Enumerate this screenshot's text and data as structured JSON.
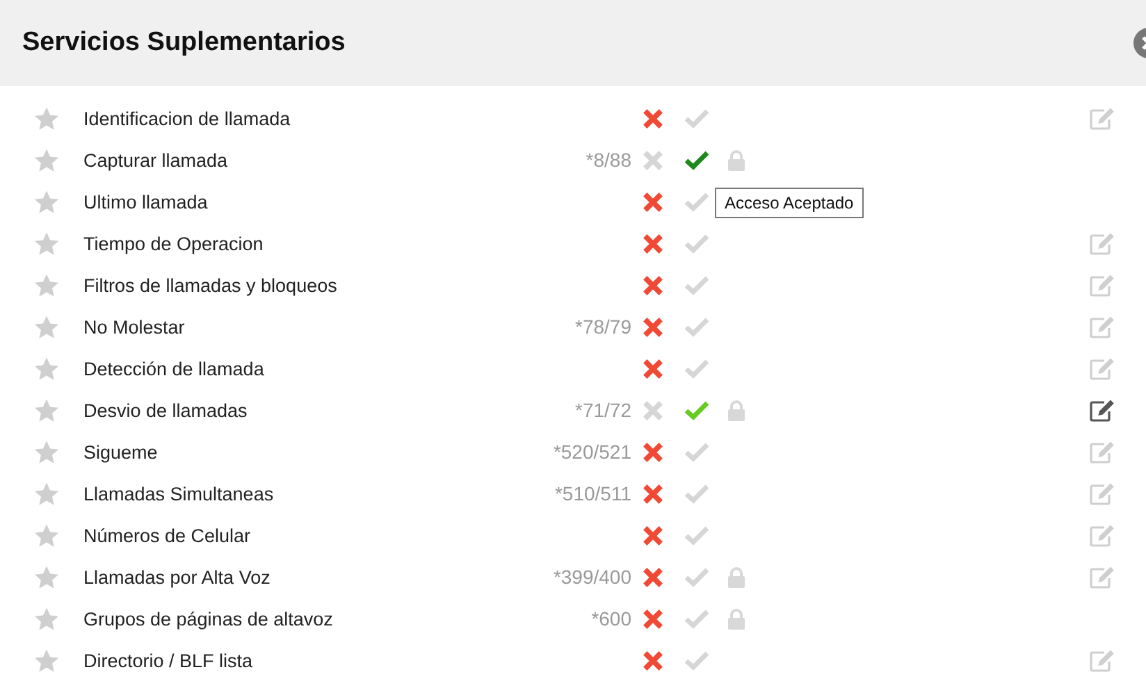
{
  "header": {
    "title": "Servicios Suplementarios"
  },
  "services": [
    {
      "name": "Identificacion de llamada",
      "denied": true,
      "accepted": false,
      "editable": true
    },
    {
      "name": "Capturar llamada",
      "code": "*8/88",
      "denied": false,
      "accepted": true,
      "color": "#1e8a1e",
      "locked": true
    },
    {
      "name": "Ultimo llamada",
      "denied": true,
      "accepted": false,
      "tooltip": "Acceso Aceptado"
    },
    {
      "name": "Tiempo de Operacion",
      "denied": true,
      "accepted": false,
      "editable": true
    },
    {
      "name": "Filtros de llamadas y bloqueos",
      "denied": true,
      "accepted": false,
      "editable": true
    },
    {
      "name": "No Molestar",
      "code": "*78/79",
      "denied": true,
      "accepted": false,
      "editable": true
    },
    {
      "name": "Detección de llamada",
      "denied": true,
      "accepted": false,
      "editable": true
    },
    {
      "name": "Desvio de llamadas",
      "code": "*71/72",
      "denied": false,
      "accepted": true,
      "color": "#66cc22",
      "locked": true,
      "editable": true,
      "highlighted": true
    },
    {
      "name": "Sigueme",
      "code": "*520/521",
      "denied": true,
      "accepted": false,
      "editable": true
    },
    {
      "name": "Llamadas Simultaneas",
      "code": "*510/511",
      "denied": true,
      "accepted": false,
      "editable": true
    },
    {
      "name": "Números de Celular",
      "denied": true,
      "accepted": false,
      "editable": true
    },
    {
      "name": "Llamadas por Alta Voz",
      "code": "*399/400",
      "denied": true,
      "accepted": false,
      "locked": true,
      "editable": true
    },
    {
      "name": "Grupos de páginas de altavoz",
      "code": "*600",
      "denied": true,
      "accepted": false,
      "locked": true
    },
    {
      "name": "Directorio / BLF lista",
      "denied": true,
      "accepted": false,
      "editable": true
    }
  ]
}
